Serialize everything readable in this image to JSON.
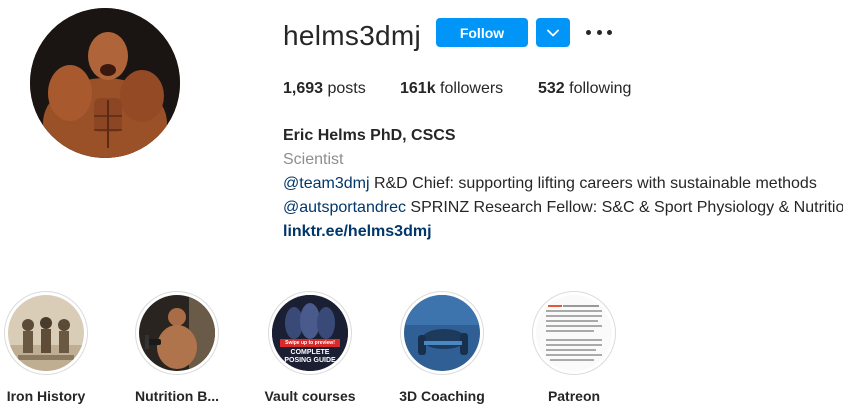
{
  "profile": {
    "username": "helms3dmj",
    "follow_label": "Follow",
    "stats": {
      "posts_count": "1,693",
      "posts_label": "posts",
      "followers_count": "161k",
      "followers_label": "followers",
      "following_count": "532",
      "following_label": "following"
    },
    "bio": {
      "name": "Eric Helms PhD, CSCS",
      "category": "Scientist",
      "line1_mention": "@team3dmj",
      "line1_text": " R&D Chief: supporting lifting careers with sustainable methods",
      "line2_mention": "@autsportandrec",
      "line2_text": " SPRINZ Research Fellow: S&C & Sport Physiology & Nutrition",
      "link": "linktr.ee/helms3dmj"
    }
  },
  "highlights": [
    {
      "label": "Iron History"
    },
    {
      "label": "Nutrition B..."
    },
    {
      "label": "Vault courses",
      "cover_text_top": "Swipe up to preview!",
      "cover_text_line1": "COMPLETE",
      "cover_text_line2": "POSING GUIDE"
    },
    {
      "label": "3D Coaching"
    },
    {
      "label": "Patreon"
    }
  ],
  "colors": {
    "follow_button": "#0095f6",
    "link": "#00376b",
    "secondary_text": "#8e8e8e",
    "text": "#262626"
  },
  "icons": [
    "chevron-down-icon",
    "more-options-icon"
  ]
}
